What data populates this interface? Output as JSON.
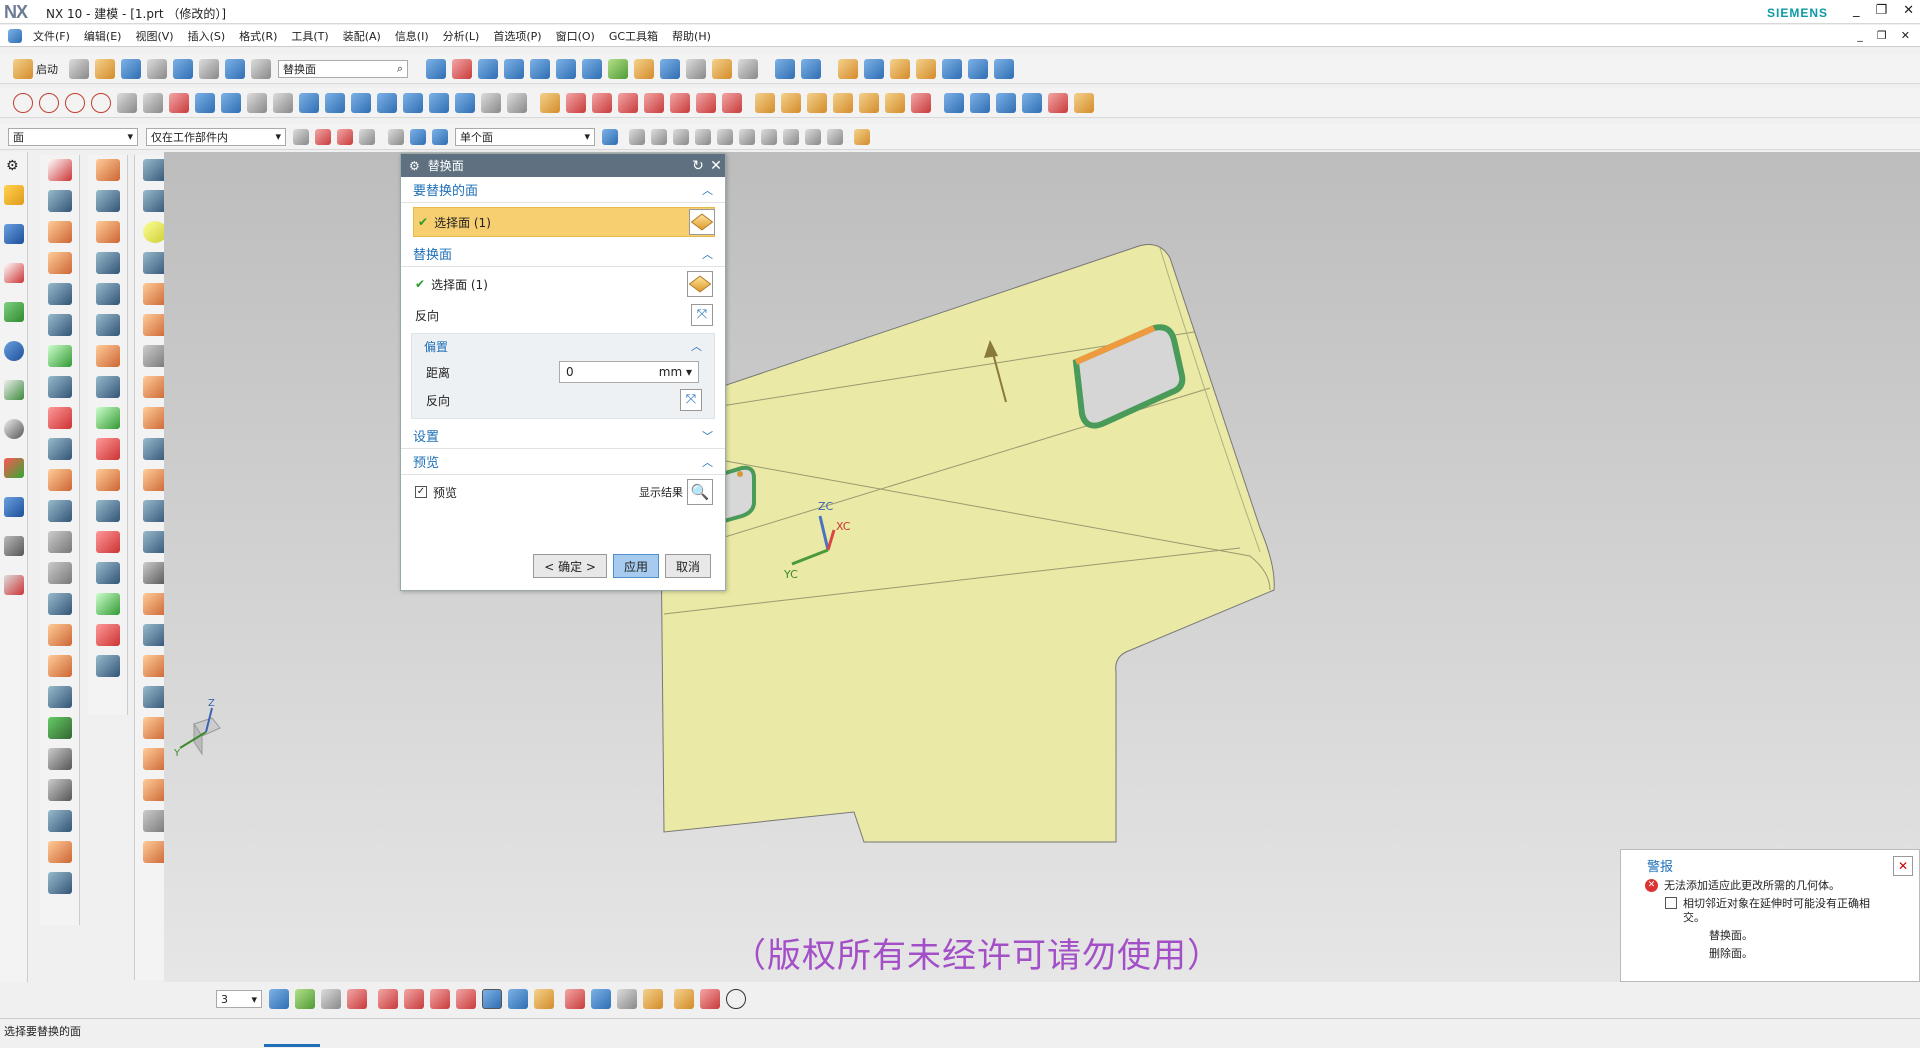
{
  "app": {
    "title": "NX 10 - 建模 - [1.prt （修改的）]",
    "logo": "NX",
    "brand": "SIEMENS",
    "window_buttons": [
      "_",
      "❐",
      "✕"
    ]
  },
  "menu": {
    "items": [
      "文件(F)",
      "编辑(E)",
      "视图(V)",
      "插入(S)",
      "格式(R)",
      "工具(T)",
      "装配(A)",
      "信息(I)",
      "分析(L)",
      "首选项(P)",
      "窗口(O)",
      "GC工具箱",
      "帮助(H)"
    ],
    "right_buttons": [
      "_",
      "❐",
      "✕"
    ]
  },
  "toolbar": {
    "start_label": "启动",
    "command_search": "替换面",
    "filter_type": "面",
    "filter_scope": "仅在工作部件内",
    "face_rule": "单个面",
    "layer_value": "3"
  },
  "dialog": {
    "title": "替换面",
    "section_target": "要替换的面",
    "target_select": "选择面 (1)",
    "section_replace": "替换面",
    "replace_select": "选择面 (1)",
    "reverse_label": "反向",
    "offset_section": "偏置",
    "distance_label": "距离",
    "distance_value": "0",
    "distance_unit": "mm",
    "offset_reverse_label": "反向",
    "settings_section": "设置",
    "preview_section": "预览",
    "preview_checkbox": "预览",
    "preview_checked": true,
    "show_result": "显示结果",
    "ok_button": "< 确定 >",
    "apply_button": "应用",
    "cancel_button": "取消"
  },
  "viewport": {
    "axis_labels": {
      "zc": "ZC",
      "xc": "XC",
      "yc": "YC"
    },
    "triad_labels": {
      "z": "Z",
      "y": "Y"
    },
    "model_color": "#eae9a6",
    "highlight_green": "#4a9a5a",
    "highlight_orange": "#f09a40"
  },
  "alert": {
    "title": "警报",
    "error": "无法添加适应此更改所需的几何体。",
    "detail": "相切邻近对象在延伸时可能没有正确相交。",
    "item1": "替换面。",
    "item2": "删除面。"
  },
  "watermark": "（版权所有未经许可请勿使用）",
  "status": {
    "prompt": "选择要替换的面"
  }
}
